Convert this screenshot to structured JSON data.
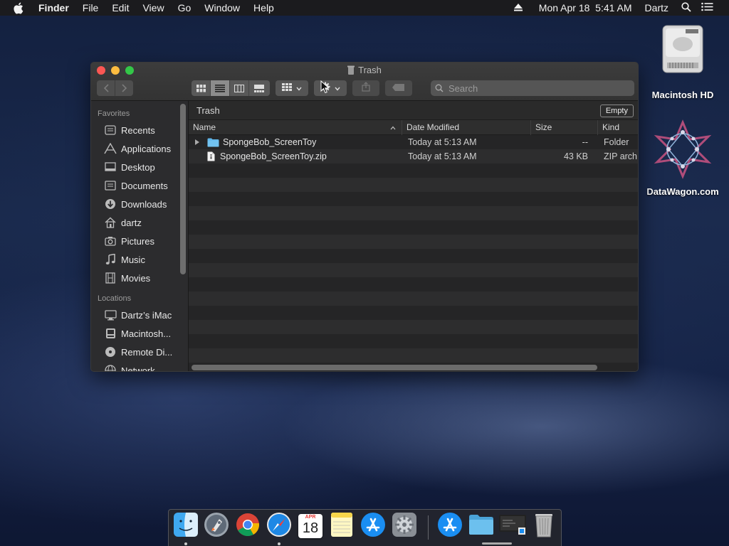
{
  "menubar": {
    "app_name": "Finder",
    "menus": [
      "File",
      "Edit",
      "View",
      "Go",
      "Window",
      "Help"
    ],
    "clock": "Mon Apr 18  5:41 AM",
    "user": "Dartz",
    "icons": [
      "apple-icon",
      "eject-icon",
      "spotlight-icon",
      "notification-center-icon"
    ]
  },
  "window": {
    "title": "Trash",
    "search_placeholder": "Search",
    "toolbar_icons": [
      "back-icon",
      "forward-icon",
      "icon-view-icon",
      "list-view-icon",
      "column-view-icon",
      "gallery-view-icon",
      "group-icon",
      "action-gear-icon",
      "share-icon",
      "tag-icon"
    ]
  },
  "sidebar": {
    "favorites_header": "Favorites",
    "favorites": [
      {
        "label": "Recents",
        "icon": "clock-icon"
      },
      {
        "label": "Applications",
        "icon": "applications-icon"
      },
      {
        "label": "Desktop",
        "icon": "desktop-icon"
      },
      {
        "label": "Documents",
        "icon": "document-icon"
      },
      {
        "label": "Downloads",
        "icon": "download-icon"
      },
      {
        "label": "dartz",
        "icon": "home-icon"
      },
      {
        "label": "Pictures",
        "icon": "camera-icon"
      },
      {
        "label": "Music",
        "icon": "music-note-icon"
      },
      {
        "label": "Movies",
        "icon": "film-icon"
      }
    ],
    "locations_header": "Locations",
    "locations": [
      {
        "label": "Dartz’s iMac",
        "icon": "imac-icon"
      },
      {
        "label": "Macintosh...",
        "icon": "hard-disk-icon"
      },
      {
        "label": "Remote Di...",
        "icon": "disc-icon"
      },
      {
        "label": "Network",
        "icon": "globe-icon"
      }
    ]
  },
  "content": {
    "path": "Trash",
    "empty_label": "Empty",
    "columns": {
      "name": "Name",
      "date": "Date Modified",
      "size": "Size",
      "kind": "Kind"
    },
    "files": [
      {
        "name": "SpongeBob_ScreenToy",
        "date": "Today at 5:13 AM",
        "size": "--",
        "kind": "Folder",
        "icon": "folder-icon"
      },
      {
        "name": "SpongeBob_ScreenToy.zip",
        "date": "Today at 5:13 AM",
        "size": "43 KB",
        "kind": "ZIP arch",
        "icon": "zip-file-icon"
      }
    ]
  },
  "desktop": {
    "icons": [
      {
        "label": "Macintosh HD",
        "icon": "hard-drive-icon"
      },
      {
        "label": "DataWagon.com",
        "icon": "datawagon-logo-icon"
      }
    ]
  },
  "dock": {
    "apps": [
      "finder-icon",
      "launchpad-icon",
      "chrome-icon",
      "safari-icon",
      "calendar-icon",
      "notes-icon",
      "app-store-icon",
      "system-preferences-icon",
      "applications-folder-icon",
      "folder-icon",
      "screenshot-icon",
      "trash-icon"
    ],
    "calendar_month": "APR",
    "calendar_day": "18"
  },
  "colors": {
    "accent_folder": "#5fb6ea",
    "close": "#fc5753",
    "minimize": "#fdbc40",
    "maximize": "#33c748"
  }
}
